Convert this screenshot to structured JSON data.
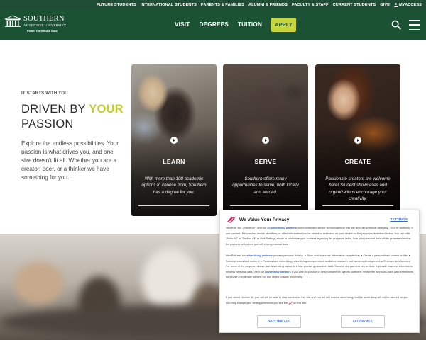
{
  "utility": {
    "links": [
      "FUTURE STUDENTS",
      "INTERNATIONAL STUDENTS",
      "PARENTS & FAMILIES",
      "ALUMNI & FRIENDS",
      "FACULTY & STAFF",
      "CURRENT STUDENTS",
      "GIVE"
    ],
    "account_label": "MYACCESS"
  },
  "logo": {
    "name": "SOUTHERN",
    "sub": "ADVENTIST UNIVERSITY",
    "tagline": "Power for Mind & Soul"
  },
  "nav": {
    "links": [
      "VISIT",
      "DEGREES",
      "TUITION"
    ],
    "apply_label": "APPLY"
  },
  "hero": {
    "eyebrow": "IT STARTS WITH YOU",
    "title_pre": "DRIVEN BY ",
    "title_accent": "YOUR",
    "title_post": "PASSION",
    "body": "Explore the endless possibilities. Your passion is what drives you, and one size doesn't fit all. Whether you are a creator, doer, or a thinker we have something for you."
  },
  "cards": [
    {
      "title": "LEARN",
      "desc": "With more than 100 academic options to choose from, Southern has a degree for you."
    },
    {
      "title": "SERVE",
      "desc": "Southern offers many opportunities to serve, both locally and abroad."
    },
    {
      "title": "CREATE",
      "desc": "Passionate creators are welcome here! Student showcases and organizations encourage your creativity."
    }
  ],
  "consent": {
    "title": "We Value Your Privacy",
    "settings_label": "SETTINGS",
    "para1_a": "NextRoll, Inc. (\"NextRoll\") and our ",
    "para1_link": "20 advertising partners",
    "para1_b": " use cookies and similar technologies on this site and use personal data (e.g., your IP address). If you consent, the cookies, device identifiers, or other information can be stored or accessed on your device for the purposes described below. You can click \"Allow All\" or \"Decline All\" or click Settings above to customize your consent regarding the purposes listed, how your personal data will be processed and/or the partners with whom you will share personal data.",
    "para2_a": "NextRoll and our ",
    "para2_link": "advertising partners",
    "para2_b": " process personal data to: ● Store and/or access information on a device; ● Create a personalised content profile; ● Select personalised content; ● Personalised advertising, advertising measurement, audience research and services development; ● Services development. For some of the purposes above, our advertising partners: ● Use precise geolocation data. Some of our partners rely on their legitimate business interests to process personal data. View our ",
    "para2_link2": "advertising partners",
    "para2_c": " if you wish to provide or deny consent for specific partners, review the purposes each partner believes they have a legitimate interest for, and object to such processing.",
    "para3_a": "If you select Decline All, you will still be able to view content on this site and you will still receive advertising, but the advertising will not be tailored for you. You may change your setting whenever you see the ",
    "para3_b": " on this site.",
    "decline_label": "DECLINE ALL",
    "allow_label": "ALLOW ALL"
  },
  "colors": {
    "brand_green": "#1c5234",
    "utility_green": "#1f4d34",
    "accent_yellow": "#c2cd2a",
    "apply_bg": "#c8d63a",
    "link_blue": "#3366cc"
  }
}
